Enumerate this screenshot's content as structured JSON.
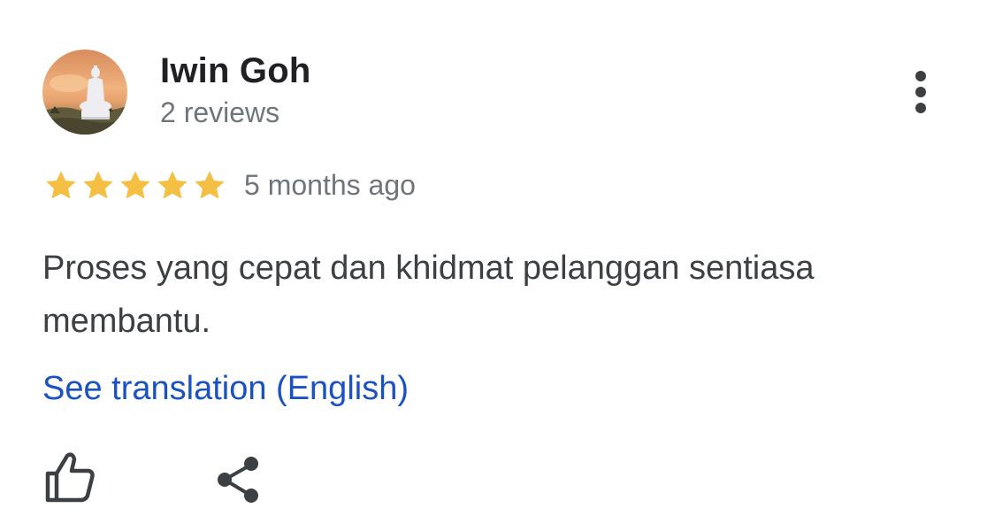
{
  "review": {
    "author_name": "Iwin Goh",
    "author_review_count": "2 reviews",
    "rating": 5,
    "rating_max": 5,
    "time_ago": "5 months ago",
    "text": "Proses yang cepat dan khidmat pelanggan sentiasa membantu.",
    "translation_link": "See translation (English)"
  },
  "icons": {
    "avatar": "buddha-statue-sunset-photo",
    "more": "more-vertical-icon",
    "star": "star-icon",
    "like": "thumbs-up-icon",
    "share": "share-icon"
  },
  "colors": {
    "star": "#f4bf42",
    "link": "#1a52c4",
    "name": "#202124",
    "secondary": "#70757a",
    "body_text": "#3c4043",
    "icon": "#5f6368"
  }
}
